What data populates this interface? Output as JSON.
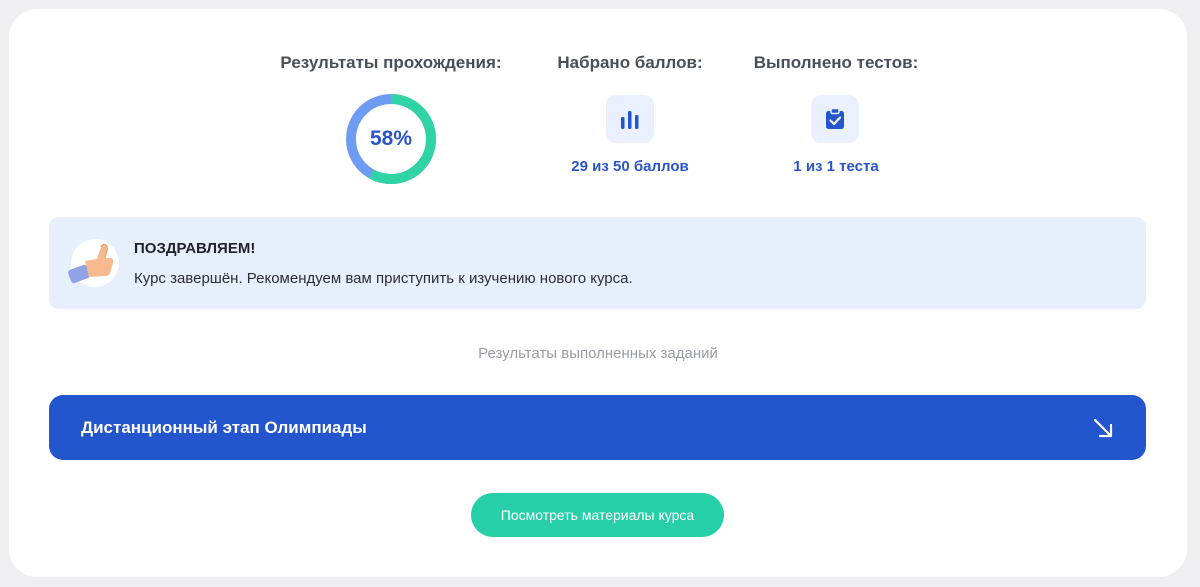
{
  "stats": {
    "progress": {
      "title": "Результаты прохождения:",
      "percent_label": "58%",
      "percent_value": 0.58,
      "colors": {
        "done": "#2fd3a4",
        "remaining": "#6f9cf3"
      }
    },
    "points": {
      "title": "Набрано баллов:",
      "value": "29 из 50 баллов",
      "icon": "bar-chart-icon"
    },
    "tests": {
      "title": "Выполнено тестов:",
      "value": "1 из 1 теста",
      "icon": "clipboard-check-icon"
    }
  },
  "congrats": {
    "icon": "thumbs-up-icon",
    "title": "ПОЗДРАВЛЯЕМ!",
    "text": "Курс завершён. Рекомендуем вам приступить к изучению нового курса."
  },
  "results_caption": "Результаты выполненных заданий",
  "stage": {
    "label": "Дистанционный этап Олимпиады",
    "icon": "arrow-down-right-icon"
  },
  "materials_button": "Посмотреть материалы курса",
  "colors": {
    "accent": "#2355cc",
    "button": "#27cfa8",
    "panel": "#e8effc"
  }
}
